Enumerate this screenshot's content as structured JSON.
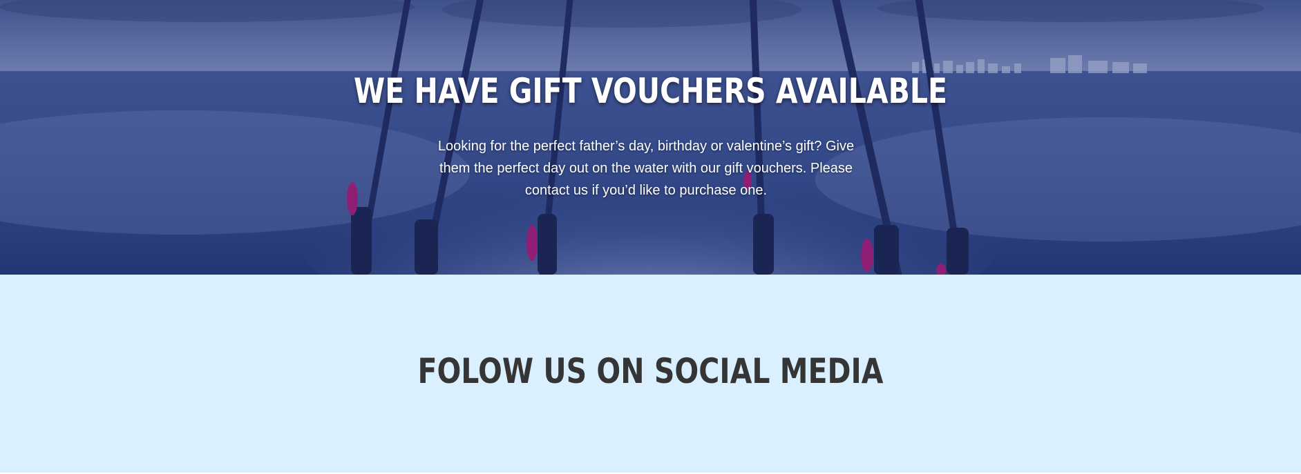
{
  "hero": {
    "title": "WE HAVE GIFT VOUCHERS AVAILABLE",
    "text": "Looking for the perfect father’s day, birthday or valentine’s gift? Give them the perfect day out on the water with our gift vouchers. Please contact us if you’d like to purchase one.",
    "background_image": "boat-wake-fishing-rods-photo"
  },
  "social": {
    "title": "FOLOW US ON SOCIAL MEDIA"
  },
  "colors": {
    "hero_overlay": "#3f5592",
    "social_bg": "#dbf0fe",
    "social_title": "#353535",
    "hero_text": "#ffffff"
  }
}
